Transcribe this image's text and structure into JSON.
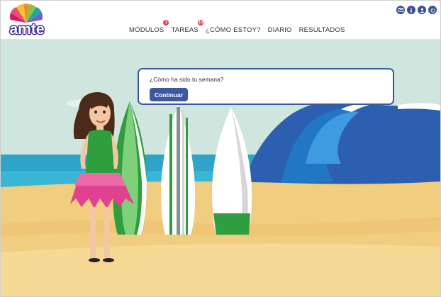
{
  "app": {
    "logo_text": "amte"
  },
  "nav": {
    "items": [
      {
        "label": "MÓDULOS",
        "badge": "1"
      },
      {
        "label": "TAREAS",
        "badge": "10"
      },
      {
        "label": "¿CÓMO ESTOY?"
      },
      {
        "label": "DIARIO"
      },
      {
        "label": "RESULTADOS"
      }
    ]
  },
  "header_icons": [
    "mail-icon",
    "info-icon",
    "user-icon",
    "power-icon"
  ],
  "dialog": {
    "question": "¿Cómo ha sido tu semana?",
    "button_label": "Continuar"
  },
  "colors": {
    "brand_blue": "#3f59a1",
    "badge_red": "#e2445c",
    "sky": "#cfe6de",
    "sea": "#2fa3c8",
    "sand": "#f1cd80"
  }
}
